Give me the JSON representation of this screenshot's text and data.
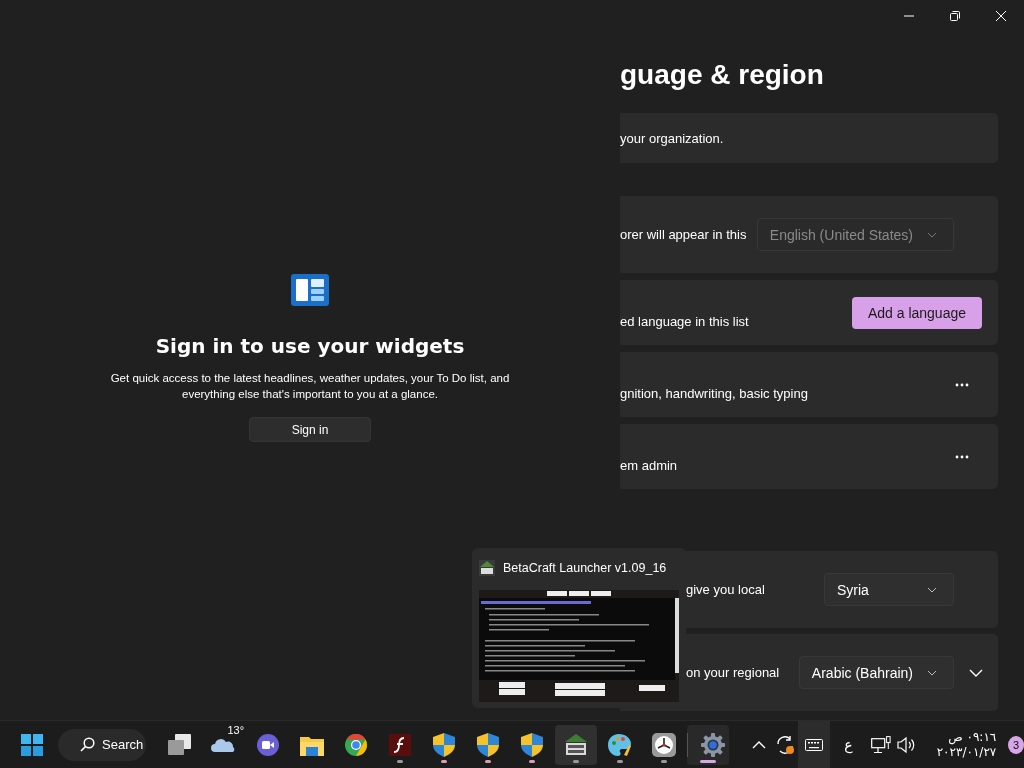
{
  "widgets_panel": {
    "heading": "Sign in to use your widgets",
    "description": "Get quick access to the latest headlines, weather updates, your To Do list, and everything else that's important to you at a glance.",
    "button": "Sign in"
  },
  "settings": {
    "window_controls": [
      {
        "kind": "minimize"
      },
      {
        "kind": "maximize"
      },
      {
        "kind": "close"
      }
    ],
    "title": "guage & region",
    "sections": [
      {
        "cards": [
          {
            "kind": "text",
            "text": "your organization."
          }
        ]
      },
      {
        "cards": [
          {
            "kind": "dropdown",
            "text": "orer will appear in this",
            "value": "English (United States)",
            "disabled": true
          },
          {
            "kind": "button",
            "text": "ed language in this list",
            "button": "Add a language"
          },
          {
            "kind": "more",
            "text": "gnition, handwriting, basic typing"
          },
          {
            "kind": "more",
            "text": "em admin"
          }
        ]
      },
      {
        "cards": [
          {
            "kind": "dropdown",
            "text": "give you local",
            "value": "Syria",
            "disabled": false
          },
          {
            "kind": "dropdown",
            "text": "on your regional",
            "value": "Arabic (Bahrain)",
            "disabled": false,
            "expanded": false
          }
        ]
      }
    ]
  },
  "preview": {
    "title": "BetaCraft Launcher v1.09_16"
  },
  "taskbar": {
    "search": "Search",
    "apps": [
      {
        "kind": "task-view",
        "running": false,
        "selected": false,
        "attention": false,
        "highlighted": false,
        "separator_before": false
      },
      {
        "kind": "weather",
        "label": "13°",
        "running": false,
        "selected": false,
        "attention": false,
        "highlighted": false,
        "separator_before": false
      },
      {
        "kind": "chat",
        "running": false,
        "selected": false,
        "attention": false,
        "highlighted": false,
        "separator_before": false
      },
      {
        "kind": "explorer",
        "running": false,
        "selected": false,
        "attention": false,
        "highlighted": false,
        "separator_before": false
      },
      {
        "kind": "browser",
        "running": false,
        "selected": false,
        "attention": false,
        "highlighted": false,
        "separator_before": false
      },
      {
        "kind": "player",
        "running": true,
        "selected": false,
        "attention": false,
        "highlighted": false,
        "separator_before": false
      },
      {
        "kind": "shield",
        "running": true,
        "selected": false,
        "attention": true,
        "highlighted": false,
        "separator_before": false
      },
      {
        "kind": "shield",
        "running": true,
        "selected": false,
        "attention": true,
        "highlighted": false,
        "separator_before": false
      },
      {
        "kind": "shield",
        "running": true,
        "selected": false,
        "attention": true,
        "highlighted": false,
        "separator_before": false
      },
      {
        "kind": "game",
        "running": true,
        "selected": false,
        "attention": false,
        "highlighted": true,
        "separator_before": false
      },
      {
        "kind": "paint",
        "running": true,
        "selected": false,
        "attention": false,
        "highlighted": false,
        "separator_before": false
      },
      {
        "kind": "clock",
        "running": true,
        "selected": false,
        "attention": false,
        "highlighted": false,
        "separator_before": false
      },
      {
        "kind": "settings",
        "running": true,
        "selected": true,
        "attention": false,
        "highlighted": false,
        "separator_before": true
      }
    ],
    "tray": [
      {
        "kind": "chevron",
        "highlighted": false
      },
      {
        "kind": "sync",
        "highlighted": false
      },
      {
        "kind": "keyboard",
        "highlighted": true
      }
    ],
    "input_language": "ع",
    "status_icons": [
      {
        "kind": "network"
      },
      {
        "kind": "volume"
      }
    ],
    "clock": {
      "time": "٠٩:١٦ ص",
      "date": "٢٠٢٣/٠١/٢٧"
    },
    "notifications": "3"
  }
}
